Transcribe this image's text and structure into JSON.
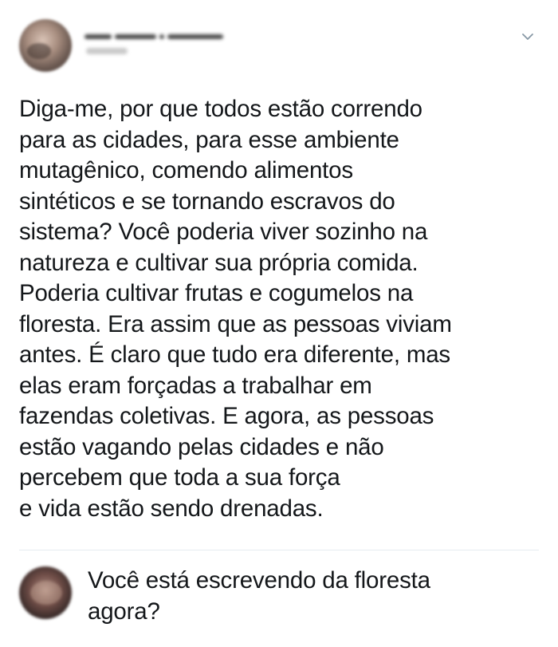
{
  "tweet": {
    "author": {
      "avatar_icon": "blurred-profile-photo",
      "name_obscured": true,
      "handle_obscured": true
    },
    "menu_icon": "chevron-down-icon",
    "text": "Diga-me, por que todos estão correndo\npara as cidades, para esse ambiente\nmutagênico, comendo alimentos\nsintéticos e se tornando escravos do\nsistema? Você poderia viver sozinho na\nnatureza e cultivar sua própria comida.\nPoderia cultivar frutas e cogumelos na\nfloresta. Era assim que as pessoas viviam\nantes. É claro que tudo era diferente, mas\nelas eram forçadas a trabalhar em\nfazendas coletivas. E agora, as pessoas\nestão vagando pelas cidades e não\npercebem que toda a sua força\ne vida estão sendo drenadas."
  },
  "reply": {
    "avatar_icon": "blurred-profile-photo",
    "text": "Você está escrevendo da floresta\nagora?"
  },
  "colors": {
    "text": "#14171a",
    "divider": "#e6ecf0",
    "chevron": "#8899a6",
    "background": "#ffffff"
  }
}
